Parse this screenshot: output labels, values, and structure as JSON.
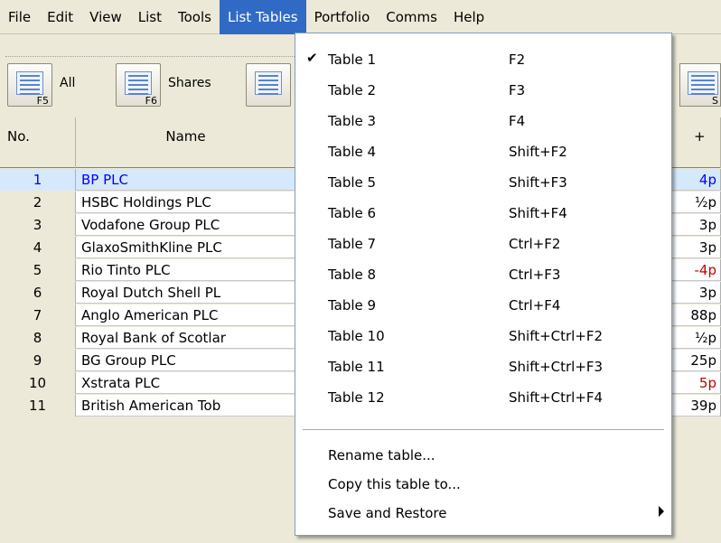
{
  "menubar": {
    "items": [
      "File",
      "Edit",
      "View",
      "List",
      "Tools",
      "List Tables",
      "Portfolio",
      "Comms",
      "Help"
    ],
    "active_index": 5
  },
  "toolbar": {
    "buttons": [
      {
        "label": "All",
        "fkey": "F5",
        "icon": "list-icon"
      },
      {
        "label": "Shares",
        "fkey": "F6",
        "icon": "list-icon"
      }
    ],
    "right_button_fkey": "S"
  },
  "table": {
    "headers": {
      "no": "No.",
      "name": "Name",
      "change": "+"
    },
    "rows": [
      {
        "no": "1",
        "name": "BP PLC",
        "change": "4p",
        "negative": false,
        "selected": true
      },
      {
        "no": "2",
        "name": "HSBC Holdings PLC",
        "change": "½p",
        "negative": false,
        "selected": false
      },
      {
        "no": "3",
        "name": "Vodafone Group PLC",
        "change": "3p",
        "negative": false,
        "selected": false
      },
      {
        "no": "4",
        "name": "GlaxoSmithKline PLC",
        "change": "3p",
        "negative": false,
        "selected": false
      },
      {
        "no": "5",
        "name": "Rio Tinto PLC",
        "change": "-4p",
        "negative": true,
        "selected": false
      },
      {
        "no": "6",
        "name": "Royal Dutch Shell PL",
        "change": "3p",
        "negative": false,
        "selected": false
      },
      {
        "no": "7",
        "name": "Anglo American PLC",
        "change": "88p",
        "negative": false,
        "selected": false
      },
      {
        "no": "8",
        "name": "Royal Bank of Scotlar",
        "change": "½p",
        "negative": false,
        "selected": false
      },
      {
        "no": "9",
        "name": "BG Group PLC",
        "change": "25p",
        "negative": false,
        "selected": false
      },
      {
        "no": "10",
        "name": "Xstrata PLC",
        "change": "5p",
        "negative": true,
        "selected": false
      },
      {
        "no": "11",
        "name": "British American Tob",
        "change": "39p",
        "negative": false,
        "selected": false
      }
    ]
  },
  "dropdown": {
    "tables": [
      {
        "label": "Table 1",
        "shortcut": "F2",
        "checked": true
      },
      {
        "label": "Table 2",
        "shortcut": "F3",
        "checked": false
      },
      {
        "label": "Table 3",
        "shortcut": "F4",
        "checked": false
      },
      {
        "label": "Table 4",
        "shortcut": "Shift+F2",
        "checked": false
      },
      {
        "label": "Table 5",
        "shortcut": "Shift+F3",
        "checked": false
      },
      {
        "label": "Table 6",
        "shortcut": "Shift+F4",
        "checked": false
      },
      {
        "label": "Table 7",
        "shortcut": "Ctrl+F2",
        "checked": false
      },
      {
        "label": "Table 8",
        "shortcut": "Ctrl+F3",
        "checked": false
      },
      {
        "label": "Table 9",
        "shortcut": "Ctrl+F4",
        "checked": false
      },
      {
        "label": "Table 10",
        "shortcut": "Shift+Ctrl+F2",
        "checked": false
      },
      {
        "label": "Table 11",
        "shortcut": "Shift+Ctrl+F3",
        "checked": false
      },
      {
        "label": "Table 12",
        "shortcut": "Shift+Ctrl+F4",
        "checked": false
      }
    ],
    "actions": [
      {
        "label": "Rename table...",
        "submenu": false
      },
      {
        "label": "Copy this table to...",
        "submenu": false
      },
      {
        "label": "Save and Restore",
        "submenu": true
      }
    ],
    "check_glyph": "✔"
  }
}
